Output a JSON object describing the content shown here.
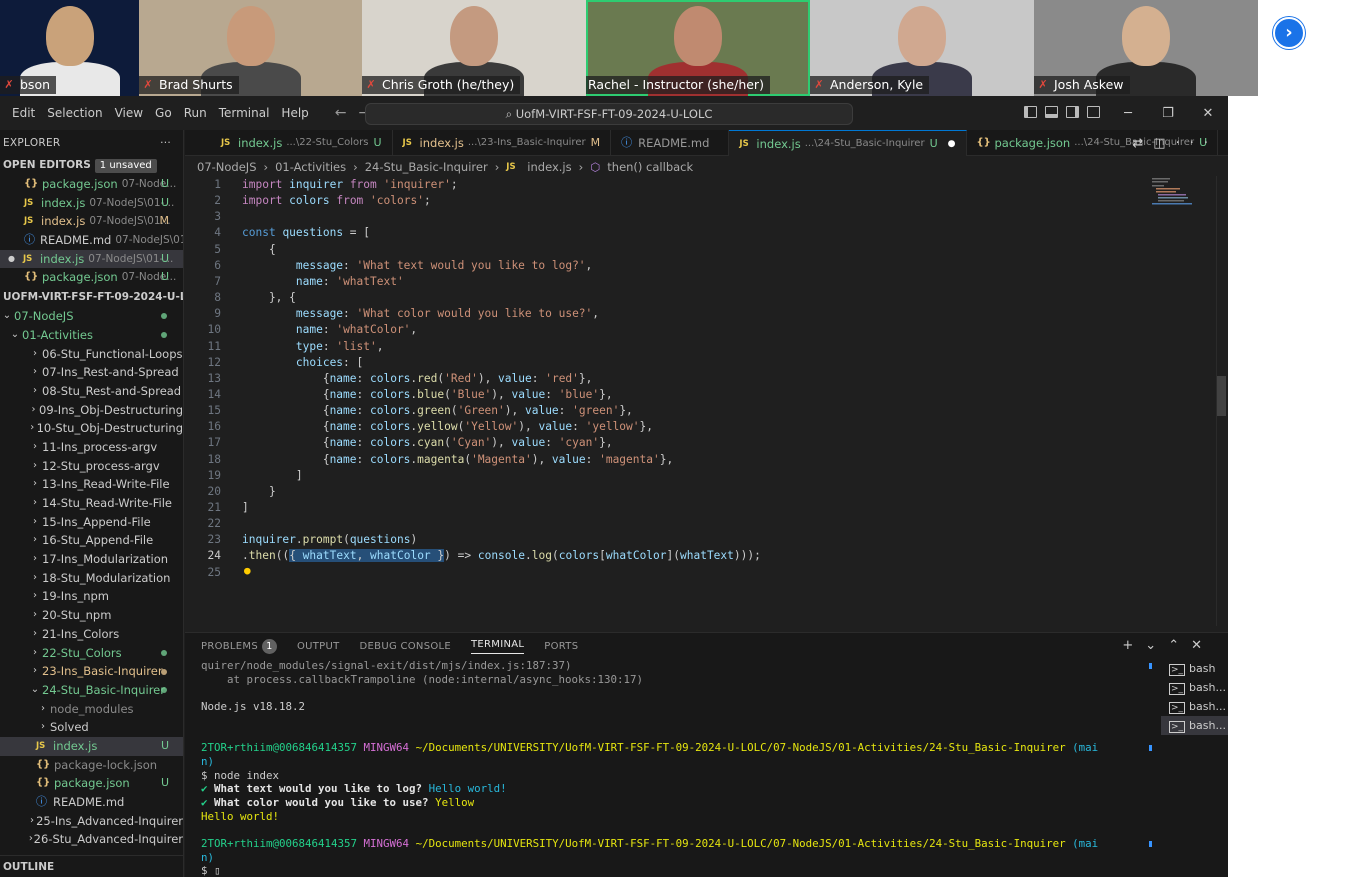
{
  "video": {
    "participants": [
      {
        "name": "bson",
        "muted": true
      },
      {
        "name": "Brad Shurts",
        "muted": true
      },
      {
        "name": "Chris Groth (he/they)",
        "muted": true
      },
      {
        "name": "Rachel - Instructor (she/her)",
        "muted": false,
        "active": true
      },
      {
        "name": "Anderson, Kyle",
        "muted": true
      },
      {
        "name": "Josh Askew",
        "muted": true
      }
    ],
    "next_icon": "chevron-right-icon"
  },
  "titlebar": {
    "menu": [
      "Edit",
      "Selection",
      "View",
      "Go",
      "Run",
      "Terminal",
      "Help"
    ],
    "search": "UofM-VIRT-FSF-FT-09-2024-U-LOLC"
  },
  "sidebar": {
    "explorer_label": "EXPLORER",
    "open_editors_label": "OPEN EDITORS",
    "unsaved_badge": "1 unsaved",
    "open_editors": [
      {
        "icon": "{}",
        "name": "package.json",
        "path": "07-Node...",
        "status": "U",
        "dirty": false
      },
      {
        "icon": "JS",
        "name": "index.js",
        "path": "07-NodeJS\\01-...",
        "status": "U",
        "dirty": false
      },
      {
        "icon": "JS",
        "name": "index.js",
        "path": "07-NodeJS\\01...",
        "status": "M",
        "dirty": false
      },
      {
        "icon": "i",
        "name": "README.md",
        "path": "07-NodeJS\\01-...",
        "status": "",
        "dirty": false
      },
      {
        "icon": "JS",
        "name": "index.js",
        "path": "07-NodeJS\\01-...",
        "status": "U",
        "dirty": true
      },
      {
        "icon": "{}",
        "name": "package.json",
        "path": "07-Node...",
        "status": "U",
        "dirty": false
      }
    ],
    "workspace_label": "UOFM-VIRT-FSF-FT-09-2024-U-LOLC",
    "tree": [
      {
        "label": "07-NodeJS",
        "indent": 0,
        "chev": "v",
        "color": "green",
        "dot": true
      },
      {
        "label": "01-Activities",
        "indent": 1,
        "chev": "v",
        "color": "green",
        "dot": true
      },
      {
        "label": "06-Stu_Functional-Loops",
        "indent": 2,
        "chev": ">",
        "color": "",
        "dot": false
      },
      {
        "label": "07-Ins_Rest-and-Spread",
        "indent": 2,
        "chev": ">",
        "color": "",
        "dot": false
      },
      {
        "label": "08-Stu_Rest-and-Spread",
        "indent": 2,
        "chev": ">",
        "color": "",
        "dot": false
      },
      {
        "label": "09-Ins_Obj-Destructuring",
        "indent": 2,
        "chev": ">",
        "color": "",
        "dot": false
      },
      {
        "label": "10-Stu_Obj-Destructuring",
        "indent": 2,
        "chev": ">",
        "color": "",
        "dot": false
      },
      {
        "label": "11-Ins_process-argv",
        "indent": 2,
        "chev": ">",
        "color": "",
        "dot": false
      },
      {
        "label": "12-Stu_process-argv",
        "indent": 2,
        "chev": ">",
        "color": "",
        "dot": false
      },
      {
        "label": "13-Ins_Read-Write-File",
        "indent": 2,
        "chev": ">",
        "color": "",
        "dot": false
      },
      {
        "label": "14-Stu_Read-Write-File",
        "indent": 2,
        "chev": ">",
        "color": "",
        "dot": false
      },
      {
        "label": "15-Ins_Append-File",
        "indent": 2,
        "chev": ">",
        "color": "",
        "dot": false
      },
      {
        "label": "16-Stu_Append-File",
        "indent": 2,
        "chev": ">",
        "color": "",
        "dot": false
      },
      {
        "label": "17-Ins_Modularization",
        "indent": 2,
        "chev": ">",
        "color": "",
        "dot": false
      },
      {
        "label": "18-Stu_Modularization",
        "indent": 2,
        "chev": ">",
        "color": "",
        "dot": false
      },
      {
        "label": "19-Ins_npm",
        "indent": 2,
        "chev": ">",
        "color": "",
        "dot": false
      },
      {
        "label": "20-Stu_npm",
        "indent": 2,
        "chev": ">",
        "color": "",
        "dot": false
      },
      {
        "label": "21-Ins_Colors",
        "indent": 2,
        "chev": ">",
        "color": "",
        "dot": false
      },
      {
        "label": "22-Stu_Colors",
        "indent": 2,
        "chev": ">",
        "color": "green",
        "dot": true
      },
      {
        "label": "23-Ins_Basic-Inquirer",
        "indent": 2,
        "chev": ">",
        "color": "orange",
        "dot": true
      },
      {
        "label": "24-Stu_Basic-Inquirer",
        "indent": 2,
        "chev": "v",
        "color": "green",
        "dot": true
      },
      {
        "label": "node_modules",
        "indent": 3,
        "chev": ">",
        "color": "dim",
        "dot": false
      },
      {
        "label": "Solved",
        "indent": 3,
        "chev": ">",
        "color": "",
        "dot": false
      },
      {
        "label": "index.js",
        "indent": 3,
        "chev": "",
        "icon": "JS",
        "color": "green",
        "status": "U",
        "selected": true
      },
      {
        "label": "package-lock.json",
        "indent": 3,
        "chev": "",
        "icon": "{}",
        "color": "dim",
        "status": ""
      },
      {
        "label": "package.json",
        "indent": 3,
        "chev": "",
        "icon": "{}",
        "color": "green",
        "status": "U"
      },
      {
        "label": "README.md",
        "indent": 3,
        "chev": "",
        "icon": "i",
        "color": "",
        "status": ""
      },
      {
        "label": "25-Ins_Advanced-Inquirer",
        "indent": 2,
        "chev": ">",
        "color": "",
        "dot": false
      },
      {
        "label": "26-Stu_Advanced-Inquirer",
        "indent": 2,
        "chev": ">",
        "color": "",
        "dot": false
      }
    ],
    "outline_label": "OUTLINE"
  },
  "tabs": [
    {
      "icon": "JS",
      "name": "index.js",
      "path": "...\\22-Stu_Colors",
      "status": "U",
      "active": false
    },
    {
      "icon": "JS",
      "name": "index.js",
      "path": "...\\23-Ins_Basic-Inquirer",
      "status": "M",
      "active": false
    },
    {
      "icon": "i",
      "name": "README.md",
      "path": "",
      "status": "",
      "active": false
    },
    {
      "icon": "JS",
      "name": "index.js",
      "path": "...\\24-Stu_Basic-Inquirer",
      "status": "U",
      "dirty": true,
      "active": true
    },
    {
      "icon": "{}",
      "name": "package.json",
      "path": "...\\24-Stu_Basic-Inquirer",
      "status": "U",
      "active": false
    }
  ],
  "breadcrumb": [
    "07-NodeJS",
    "01-Activities",
    "24-Stu_Basic-Inquirer",
    "index.js",
    "then() callback"
  ],
  "editor": {
    "current_line": 24,
    "lines": [
      "import inquirer from 'inquirer';",
      "import colors from 'colors';",
      "",
      "const questions = [",
      "    {",
      "        message: 'What text would you like to log?',",
      "        name: 'whatText'",
      "    }, {",
      "        message: 'What color would you like to use?',",
      "        name: 'whatColor',",
      "        type: 'list',",
      "        choices: [",
      "            {name: colors.red('Red'), value: 'red'},",
      "            {name: colors.blue('Blue'), value: 'blue'},",
      "            {name: colors.green('Green'), value: 'green'},",
      "            {name: colors.yellow('Yellow'), value: 'yellow'},",
      "            {name: colors.cyan('Cyan'), value: 'cyan'},",
      "            {name: colors.magenta('Magenta'), value: 'magenta'},",
      "        ]",
      "    }",
      "]",
      "",
      "inquirer.prompt(questions)",
      ".then(({ whatText, whatColor }) => console.log(colors[whatColor](whatText)));",
      ""
    ]
  },
  "panel": {
    "tabs": [
      "PROBLEMS",
      "OUTPUT",
      "DEBUG CONSOLE",
      "TERMINAL",
      "PORTS"
    ],
    "active_tab": "TERMINAL",
    "problems_count": "1",
    "terminal": [
      {
        "text": "quirer/node_modules/signal-exit/dist/mjs/index.js:187:37)",
        "cls": "tdim"
      },
      {
        "text": "    at process.callbackTrampoline (node:internal/async_hooks:130:17)",
        "cls": "tdim"
      },
      {
        "text": "",
        "cls": ""
      },
      {
        "text": "Node.js v18.18.2",
        "cls": ""
      },
      {
        "text": "",
        "cls": ""
      },
      {
        "text": "",
        "cls": ""
      },
      {
        "prompt": true,
        "user": "2TOR+rthiim@006846414357",
        "host": "MINGW64",
        "path": "~/Documents/UNIVERSITY/UofM-VIRT-FSF-FT-09-2024-U-LOLC/07-NodeJS/01-Activities/24-Stu_Basic-Inquirer",
        "branch": "(mai"
      },
      {
        "text": "n)",
        "cls": "tcyan"
      },
      {
        "text": "$ node index",
        "cls": ""
      },
      {
        "q": true,
        "check": "✔",
        "question": "What text would you like to log?",
        "answer": "Hello world!",
        "acls": "tcyan"
      },
      {
        "q": true,
        "check": "✔",
        "question": "What color would you like to use?",
        "answer": "Yellow",
        "acls": "tyel"
      },
      {
        "text": "Hello world!",
        "cls": "tyel"
      },
      {
        "text": "",
        "cls": ""
      },
      {
        "prompt": true,
        "user": "2TOR+rthiim@006846414357",
        "host": "MINGW64",
        "path": "~/Documents/UNIVERSITY/UofM-VIRT-FSF-FT-09-2024-U-LOLC/07-NodeJS/01-Activities/24-Stu_Basic-Inquirer",
        "branch": "(mai"
      },
      {
        "text": "n)",
        "cls": "tcyan"
      },
      {
        "text": "$ ▯",
        "cls": ""
      }
    ],
    "terminals": [
      "bash",
      "bash...",
      "bash...",
      "bash..."
    ]
  }
}
